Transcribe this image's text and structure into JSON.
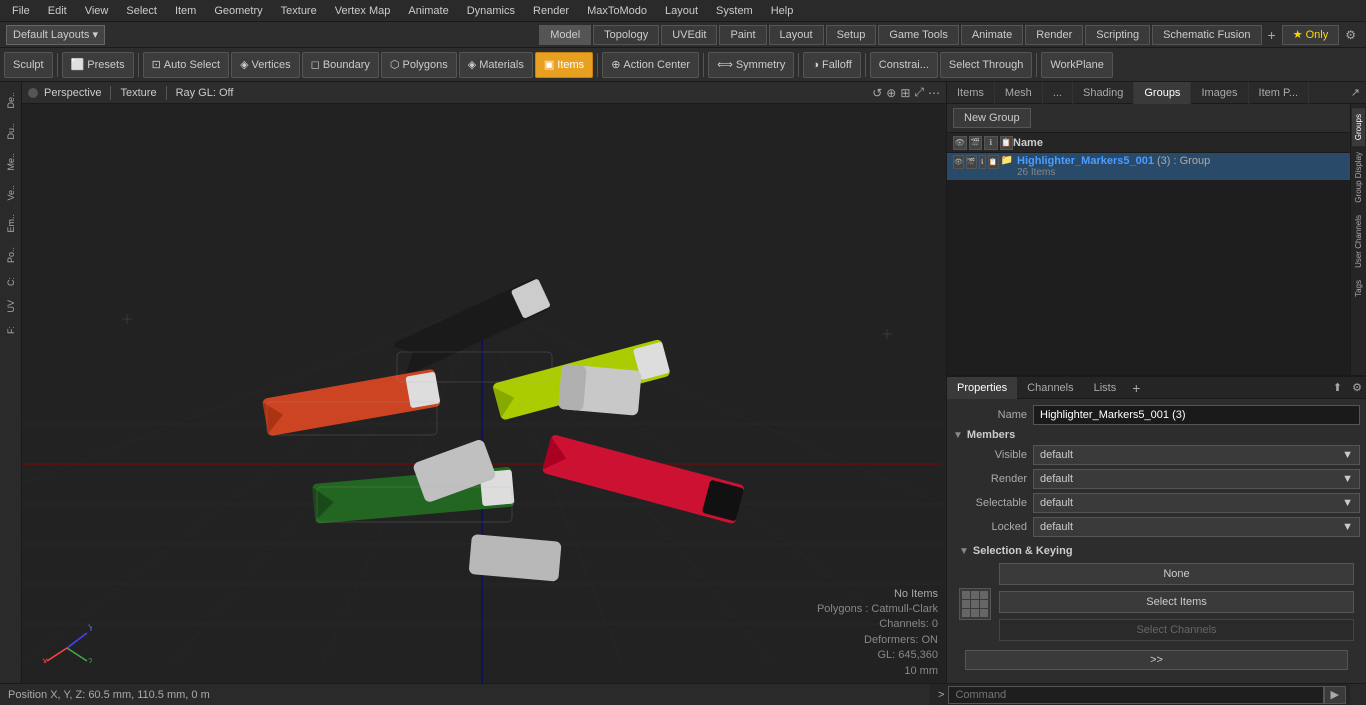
{
  "menubar": {
    "items": [
      "File",
      "Edit",
      "View",
      "Select",
      "Item",
      "Geometry",
      "Texture",
      "Vertex Map",
      "Animate",
      "Dynamics",
      "Render",
      "MaxToModo",
      "Layout",
      "System",
      "Help"
    ]
  },
  "layoutbar": {
    "dropdown_label": "Default Layouts ▾",
    "modes": [
      "Model",
      "Topology",
      "UVEdit",
      "Paint",
      "Layout",
      "Setup",
      "Game Tools",
      "Animate",
      "Render",
      "Scripting",
      "Schematic Fusion"
    ],
    "active_mode": "Model",
    "only_label": "★  Only",
    "add_icon": "+",
    "gear_icon": "⚙"
  },
  "toolbar": {
    "sculpt_label": "Sculpt",
    "presets_label": "Presets",
    "auto_select_label": "Auto Select",
    "vertices_label": "Vertices",
    "boundary_label": "Boundary",
    "polygons_label": "Polygons",
    "materials_label": "Materials",
    "items_label": "Items",
    "action_center_label": "Action Center",
    "symmetry_label": "Symmetry",
    "falloff_label": "Falloff",
    "constraint_label": "Constrai...",
    "select_through_label": "Select Through",
    "workplane_label": "WorkPlane"
  },
  "viewport": {
    "dot_label": "•",
    "perspective_label": "Perspective",
    "texture_label": "Texture",
    "raygl_label": "Ray GL: Off",
    "status": {
      "no_items": "No Items",
      "polygons": "Polygons : Catmull-Clark",
      "channels": "Channels: 0",
      "deformers": "Deformers: ON",
      "gl": "GL: 645,360",
      "unit": "10 mm"
    }
  },
  "axes": {
    "x_label": "X",
    "y_label": "Y",
    "z_label": "Z"
  },
  "sidebar_left": {
    "tabs": [
      "De..",
      "Du..",
      "Me..",
      "Ve..",
      "Em..",
      "Po..",
      "C:",
      "UV",
      "F:"
    ]
  },
  "panel": {
    "tabs": [
      "Items",
      "Mesh",
      "...",
      "Shading",
      "Groups",
      "Images",
      "Item P..."
    ],
    "active_tab": "Groups",
    "expand_icon": "⬆",
    "arrow_icon": "↗"
  },
  "groups_panel": {
    "new_group_label": "New Group",
    "col_name": "Name",
    "header_icons": [
      "👁",
      "🎬",
      "ℹ",
      "📋"
    ],
    "items": [
      {
        "name": "Highlighter_Markers5_001",
        "detail": "(3) : Group",
        "sub": "26 Items"
      }
    ]
  },
  "properties": {
    "tabs": [
      "Properties",
      "Channels",
      "Lists"
    ],
    "add_icon": "+",
    "active_tab": "Properties",
    "name_label": "Name",
    "name_value": "Highlighter_Markers5_001 (3)",
    "members_section": "Members",
    "visible_label": "Visible",
    "visible_value": "default",
    "render_label": "Render",
    "render_value": "default",
    "selectable_label": "Selectable",
    "selectable_value": "default",
    "locked_label": "Locked",
    "locked_value": "default",
    "sel_keying_section": "Selection & Keying",
    "none_label": "None",
    "select_items_label": "Select Items",
    "select_channels_label": "Select Channels"
  },
  "right_sidebar": {
    "tabs": [
      "Groups",
      "Group Display",
      "User Channels",
      "Tags"
    ]
  },
  "status_bar": {
    "position_label": "Position X, Y, Z:",
    "position_value": "60.5 mm, 110.5 mm, 0 m"
  },
  "command_bar": {
    "arrow_label": ">",
    "placeholder": "Command",
    "send_icon": "▶"
  }
}
